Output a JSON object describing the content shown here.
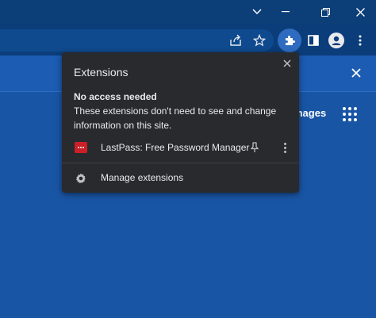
{
  "window": {
    "controls": [
      "chevron-down-icon",
      "minimize-icon",
      "restore-icon",
      "close-icon"
    ]
  },
  "toolbar": {
    "icons": [
      "share-icon",
      "star-icon",
      "extensions-icon",
      "side-panel-icon",
      "profile-icon",
      "menu-icon"
    ]
  },
  "page": {
    "images_label": "mages"
  },
  "extensions_popup": {
    "title": "Extensions",
    "no_access_heading": "No access needed",
    "no_access_description": "These extensions don't need to see and change information on this site.",
    "extensions": [
      {
        "name": "LastPass: Free Password Manager",
        "icon": "lastpass-icon"
      }
    ],
    "manage_label": "Manage extensions"
  },
  "colors": {
    "page_background": "#1955a5",
    "popup_background": "#292a2d",
    "lastpass_red": "#cc2029"
  }
}
